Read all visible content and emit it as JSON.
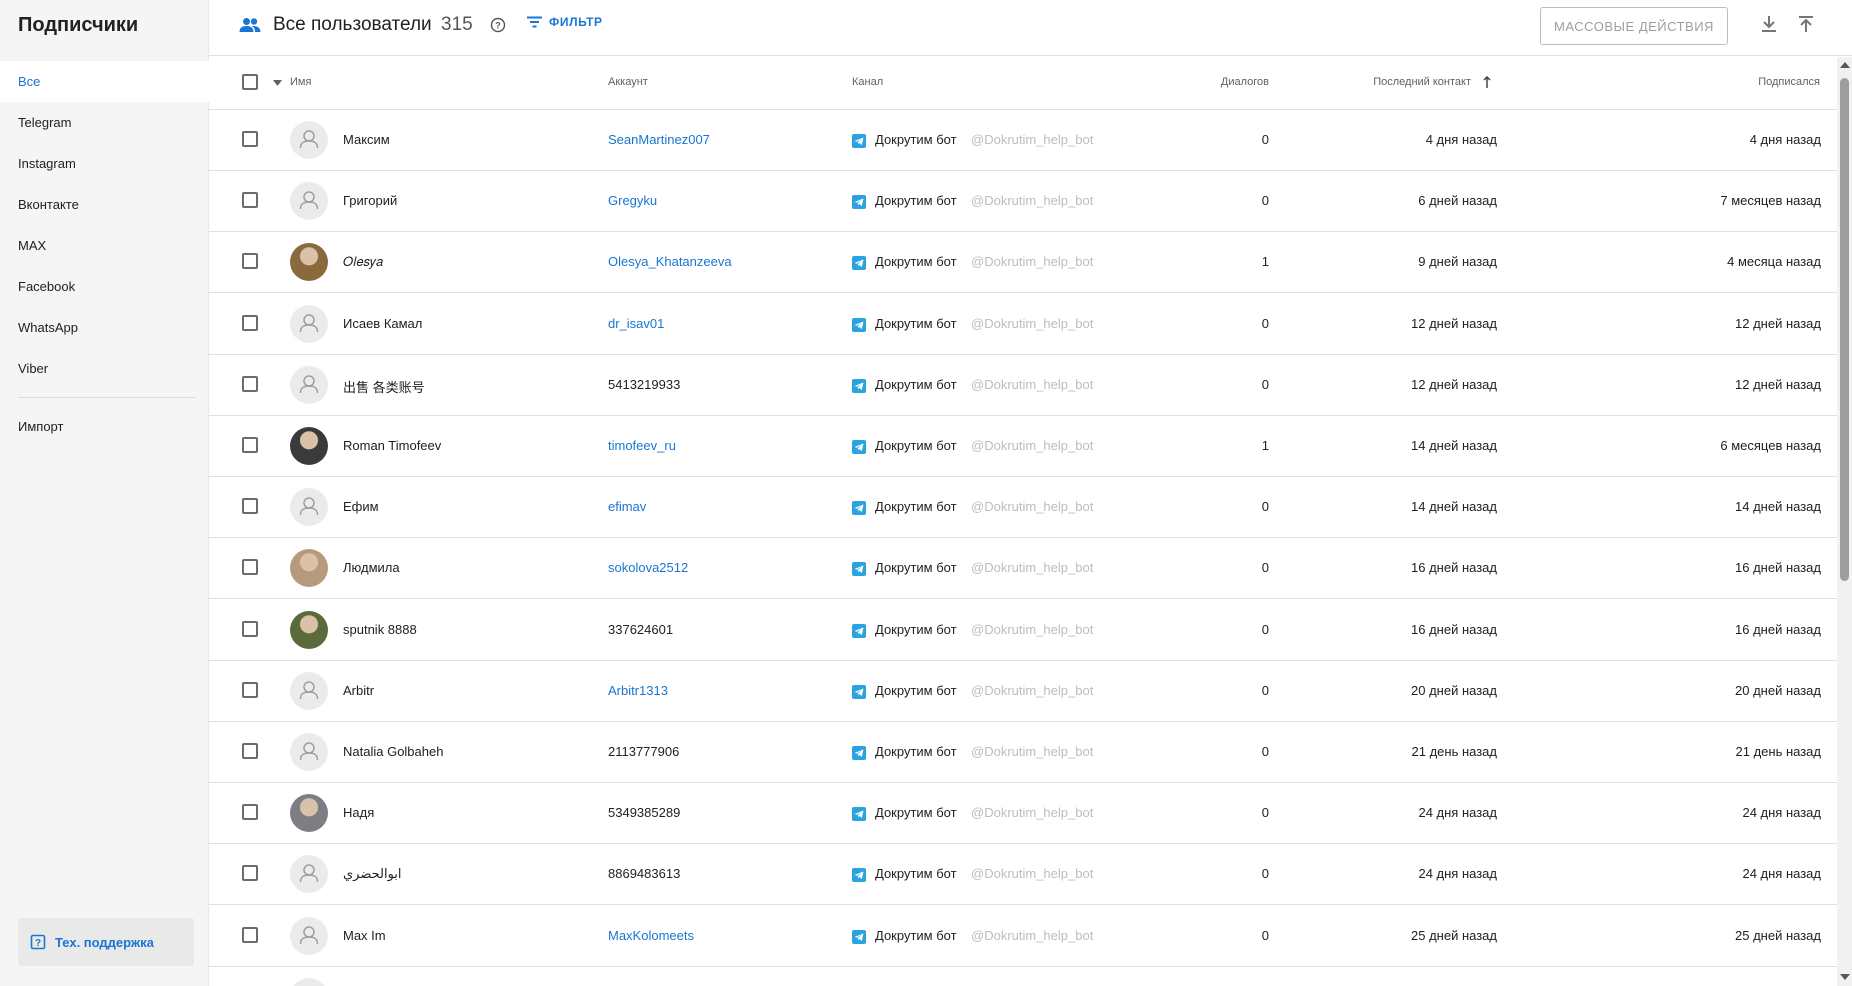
{
  "sidebar": {
    "title": "Подписчики",
    "items": [
      {
        "label": "Все",
        "active": true
      },
      {
        "label": "Telegram"
      },
      {
        "label": "Instagram"
      },
      {
        "label": "Вконтакте"
      },
      {
        "label": "MAX"
      },
      {
        "label": "Facebook"
      },
      {
        "label": "WhatsApp"
      },
      {
        "label": "Viber"
      }
    ],
    "import_label": "Импорт",
    "support_label": "Тех. поддержка"
  },
  "header": {
    "title": "Все пользователи",
    "count": "315",
    "filter_label": "ФИЛЬТР",
    "mass_actions_label": "МАССОВЫЕ ДЕЙСТВИЯ"
  },
  "table": {
    "columns": {
      "name": "Имя",
      "account": "Аккаунт",
      "channel": "Канал",
      "dialogs": "Диалогов",
      "last_contact": "Последний контакт",
      "subscribed": "Подписался"
    },
    "rows": [
      {
        "name": "Максим",
        "account": "SeanMartinez007",
        "account_is_link": true,
        "channel": "Докрутим бот",
        "handle": "@Dokrutim_help_bot",
        "dialogs": "0",
        "last_contact": "4 дня назад",
        "subscribed": "4 дня назад",
        "avatar": "placeholder"
      },
      {
        "name": "Григорий",
        "account": "Gregyku",
        "account_is_link": true,
        "channel": "Докрутим бот",
        "handle": "@Dokrutim_help_bot",
        "dialogs": "0",
        "last_contact": "6 дней назад",
        "subscribed": "7 месяцев назад",
        "avatar": "placeholder"
      },
      {
        "name": "𝑂𝑙𝑒𝑠𝑦𝑎",
        "account": "Olesya_Khatanzeeva",
        "account_is_link": true,
        "channel": "Докрутим бот",
        "handle": "@Dokrutim_help_bot",
        "dialogs": "1",
        "last_contact": "9 дней назад",
        "subscribed": "4 месяца назад",
        "avatar": "photo"
      },
      {
        "name": "Исаев Камал",
        "account": "dr_isav01",
        "account_is_link": true,
        "channel": "Докрутим бот",
        "handle": "@Dokrutim_help_bot",
        "dialogs": "0",
        "last_contact": "12 дней назад",
        "subscribed": "12 дней назад",
        "avatar": "placeholder"
      },
      {
        "name": "出售 各类账号",
        "account": "5413219933",
        "account_is_link": false,
        "channel": "Докрутим бот",
        "handle": "@Dokrutim_help_bot",
        "dialogs": "0",
        "last_contact": "12 дней назад",
        "subscribed": "12 дней назад",
        "avatar": "placeholder"
      },
      {
        "name": "Roman Timofeev",
        "account": "timofeev_ru",
        "account_is_link": true,
        "channel": "Докрутим бот",
        "handle": "@Dokrutim_help_bot",
        "dialogs": "1",
        "last_contact": "14 дней назад",
        "subscribed": "6 месяцев назад",
        "avatar": "photo"
      },
      {
        "name": "Ефим",
        "account": "efimav",
        "account_is_link": true,
        "channel": "Докрутим бот",
        "handle": "@Dokrutim_help_bot",
        "dialogs": "0",
        "last_contact": "14 дней назад",
        "subscribed": "14 дней назад",
        "avatar": "placeholder"
      },
      {
        "name": "Людмила",
        "account": "sokolova2512",
        "account_is_link": true,
        "channel": "Докрутим бот",
        "handle": "@Dokrutim_help_bot",
        "dialogs": "0",
        "last_contact": "16 дней назад",
        "subscribed": "16 дней назад",
        "avatar": "photo"
      },
      {
        "name": "sputnik 8888",
        "account": "337624601",
        "account_is_link": false,
        "channel": "Докрутим бот",
        "handle": "@Dokrutim_help_bot",
        "dialogs": "0",
        "last_contact": "16 дней назад",
        "subscribed": "16 дней назад",
        "avatar": "photo"
      },
      {
        "name": "Arbitr",
        "account": "Arbitr1313",
        "account_is_link": true,
        "channel": "Докрутим бот",
        "handle": "@Dokrutim_help_bot",
        "dialogs": "0",
        "last_contact": "20 дней назад",
        "subscribed": "20 дней назад",
        "avatar": "placeholder"
      },
      {
        "name": "Natalia Golbaheh",
        "account": "2113777906",
        "account_is_link": false,
        "channel": "Докрутим бот",
        "handle": "@Dokrutim_help_bot",
        "dialogs": "0",
        "last_contact": "21 день назад",
        "subscribed": "21 день назад",
        "avatar": "placeholder"
      },
      {
        "name": "Надя",
        "account": "5349385289",
        "account_is_link": false,
        "channel": "Докрутим бот",
        "handle": "@Dokrutim_help_bot",
        "dialogs": "0",
        "last_contact": "24 дня назад",
        "subscribed": "24 дня назад",
        "avatar": "photo"
      },
      {
        "name": "ابوالحضري",
        "account": "8869483613",
        "account_is_link": false,
        "channel": "Докрутим бот",
        "handle": "@Dokrutim_help_bot",
        "dialogs": "0",
        "last_contact": "24 дня назад",
        "subscribed": "24 дня назад",
        "avatar": "placeholder"
      },
      {
        "name": "Max Im",
        "account": "MaxKolomeets",
        "account_is_link": true,
        "channel": "Докрутим бот",
        "handle": "@Dokrutim_help_bot",
        "dialogs": "0",
        "last_contact": "25 дней назад",
        "subscribed": "25 дней назад",
        "avatar": "placeholder"
      }
    ]
  },
  "colors": {
    "accent": "#1976d2",
    "telegram": "#2aa3e0",
    "sidebar_bg": "#f5f5f5",
    "muted": "#bdbdbd"
  },
  "icons": [
    "users-icon",
    "help-icon",
    "filter-icon",
    "download-icon",
    "upload-icon",
    "telegram-icon",
    "support-icon",
    "sort-desc-icon",
    "sort-asc-arrow-icon",
    "user-placeholder-icon"
  ]
}
